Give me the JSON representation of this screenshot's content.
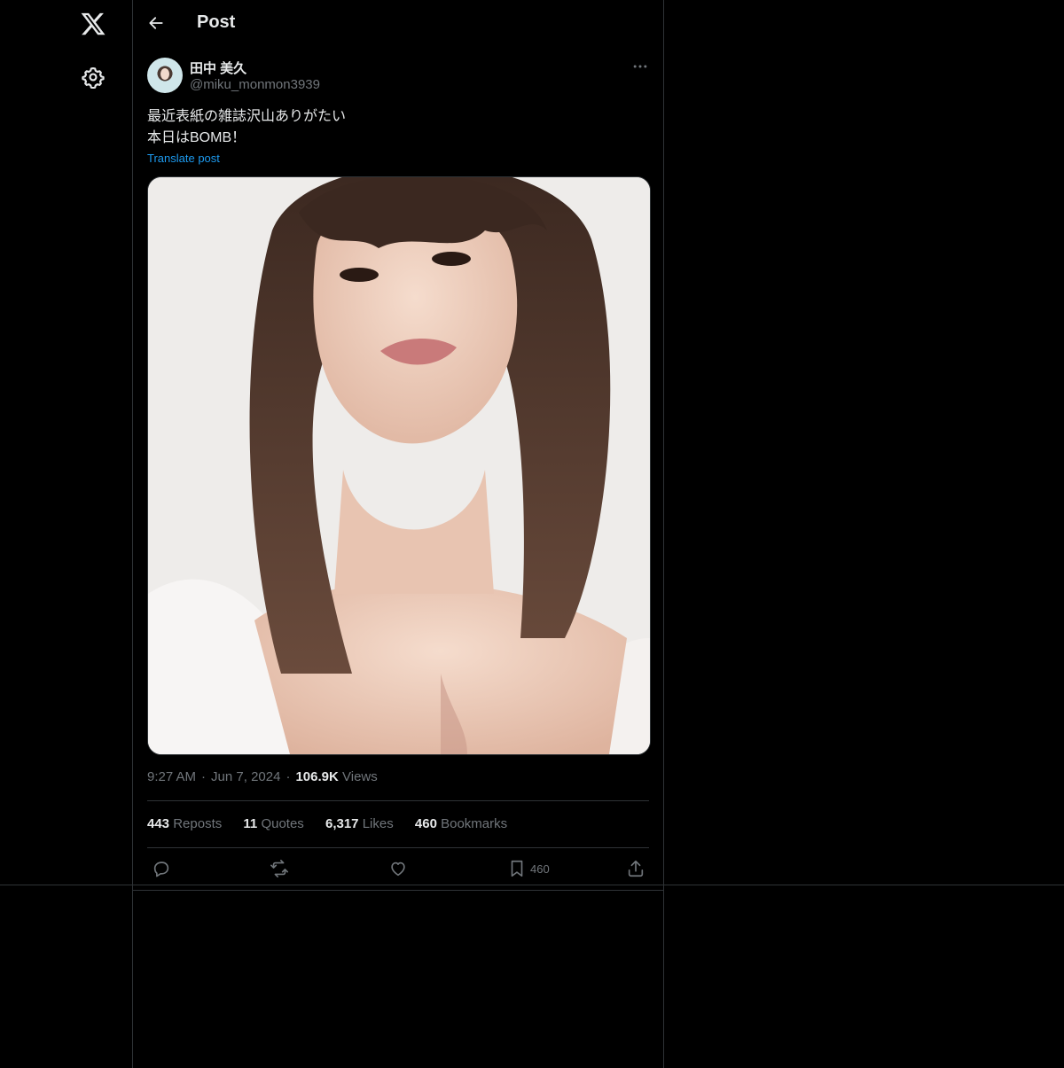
{
  "header": {
    "title": "Post"
  },
  "author": {
    "name": "田中 美久",
    "handle": "@miku_monmon3939"
  },
  "post": {
    "text": "最近表紙の雑誌沢山ありがたい\n本日はBOMB！",
    "translate_label": "Translate post",
    "time": "9:27 AM",
    "date": "Jun 7, 2024",
    "views_count": "106.9K",
    "views_label": "Views"
  },
  "stats": {
    "reposts_count": "443",
    "reposts_label": "Reposts",
    "quotes_count": "11",
    "quotes_label": "Quotes",
    "likes_count": "6,317",
    "likes_label": "Likes",
    "bookmarks_count": "460",
    "bookmarks_label": "Bookmarks"
  },
  "actions": {
    "bookmark_count": "460"
  },
  "icons": {
    "logo": "x-logo-icon",
    "settings": "gear-icon",
    "back": "arrow-left-icon",
    "more": "more-horizontal-icon",
    "reply": "reply-icon",
    "repost": "repost-icon",
    "like": "heart-icon",
    "bookmark": "bookmark-icon",
    "share": "share-icon"
  },
  "colors": {
    "background": "#000000",
    "text": "#e7e9ea",
    "secondary": "#71767b",
    "link": "#1d9bf0",
    "border": "#2f3336"
  }
}
